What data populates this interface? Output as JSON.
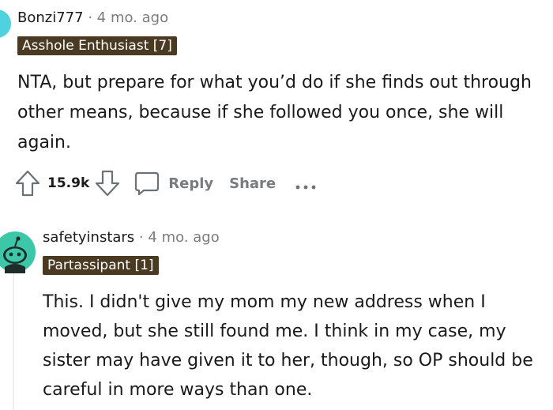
{
  "comments": [
    {
      "author": "Bonzi777",
      "separator": "·",
      "time": "4 mo. ago",
      "flair": "Asshole Enthusiast [7]",
      "body": "NTA, but prepare for what you’d do if she finds out through other means, because if she followed you once, she will again.",
      "score": "15.9k",
      "actions": {
        "reply": "Reply",
        "share": "Share"
      }
    },
    {
      "author": "safetyinstars",
      "separator": "·",
      "time": "4 mo. ago",
      "flair": "Partassipant [1]",
      "body": "This. I didn't give my mom my new address when I moved, but she still found me. I think in my case, my sister may have given it to her, though, so OP should be careful in more ways than one."
    }
  ],
  "icons": {
    "upvote": "arrow-up-icon",
    "downvote": "arrow-down-icon",
    "reply": "speech-bubble-icon",
    "more": "ellipsis-icon"
  },
  "colors": {
    "flair_bg": "#4a3a22",
    "avatar_top": "#4fd1e0",
    "avatar_nested": "#3cc8a8",
    "muted_text": "#787c7e"
  }
}
